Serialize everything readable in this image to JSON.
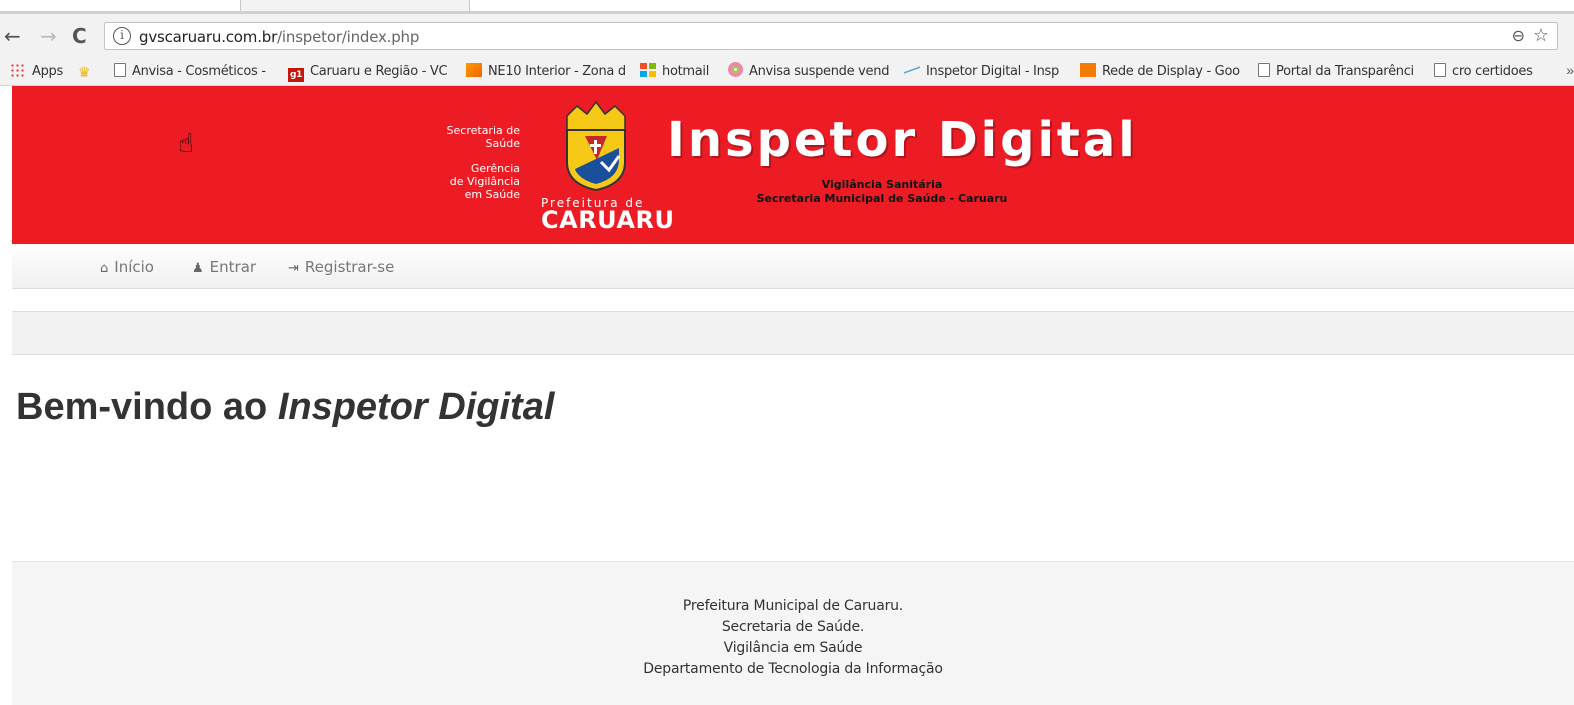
{
  "browser": {
    "url_host": "gvscaruaru.com.br",
    "url_path": "/inspetor/index.php",
    "back_icon": "←",
    "forward_icon": "→",
    "reload_icon": "C"
  },
  "bookmarks": [
    {
      "label": "Apps",
      "icon": "apps-icon"
    },
    {
      "label": "",
      "icon": "crown-icon"
    },
    {
      "label": "Anvisa - Cosméticos -",
      "icon": "page-icon"
    },
    {
      "label": "Caruaru e Região - VC",
      "icon": "g1-icon"
    },
    {
      "label": "NE10 Interior - Zona d",
      "icon": "ne10-icon"
    },
    {
      "label": "hotmail",
      "icon": "microsoft-icon"
    },
    {
      "label": "Anvisa suspende vend",
      "icon": "ring-icon"
    },
    {
      "label": "Inspetor Digital - Insp",
      "icon": "line-icon"
    },
    {
      "label": "Rede de Display - Goo",
      "icon": "chart-icon"
    },
    {
      "label": "Portal da Transparênci",
      "icon": "page-icon"
    },
    {
      "label": "cro certidoes",
      "icon": "page-icon"
    }
  ],
  "header": {
    "left_lines": [
      "Secretaria de",
      "Saúde",
      "Gerência",
      "de Vigilância",
      "em Saúde"
    ],
    "prefeitura_small": "Prefeitura de",
    "prefeitura_big": "CARUARU",
    "title": "Inspetor Digital",
    "subtitle_1": "Vigilância Sanitária",
    "subtitle_2": "Secretaria Municipal de Saúde - Caruaru",
    "brand_color": "#ed1c24"
  },
  "nav": {
    "home": "Início",
    "login": "Entrar",
    "register": "Registrar-se"
  },
  "main": {
    "welcome_prefix": "Bem-vindo ao ",
    "welcome_emphasis": "Inspetor Digital"
  },
  "footer": {
    "lines": [
      "Prefeitura Municipal de Caruaru.",
      "Secretaria de Saúde.",
      "Vigilância em Saúde",
      "Departamento de Tecnologia da Informação"
    ]
  }
}
